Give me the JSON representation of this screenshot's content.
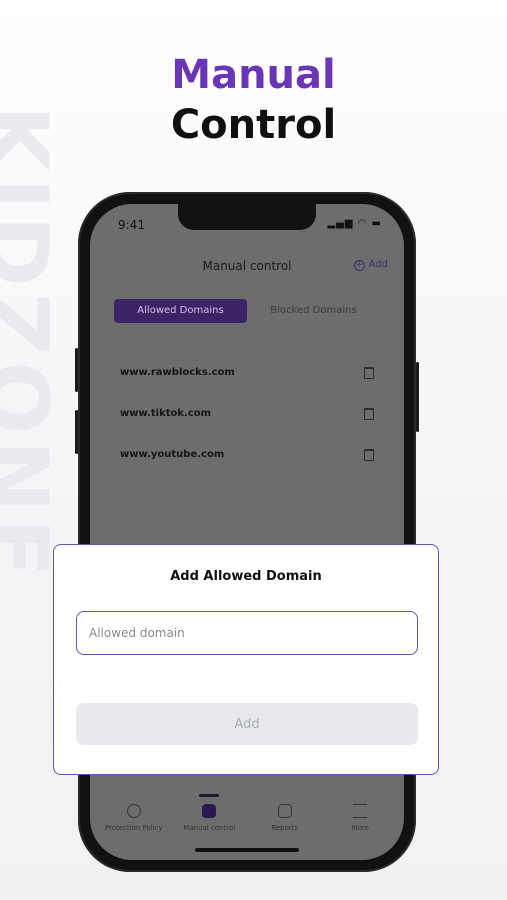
{
  "headline": {
    "line1": "Manual",
    "line2": "Control"
  },
  "watermark": "KIDZONE",
  "status": {
    "time": "9:41",
    "icons": "▂▄▆ ◠ ▬"
  },
  "app": {
    "title": "Manual control",
    "add_label": "Add",
    "tabs": [
      {
        "label": "Allowed Domains",
        "active": true
      },
      {
        "label": "Blocked Domains",
        "active": false
      }
    ],
    "domains": [
      "www.rawblocks.com",
      "www.tiktok.com",
      "www.youtube.com"
    ],
    "bottom_tabs": [
      {
        "label": "Protection Policy",
        "active": false
      },
      {
        "label": "Manual control",
        "active": true
      },
      {
        "label": "Reports",
        "active": false
      },
      {
        "label": "More",
        "active": false
      }
    ]
  },
  "dialog": {
    "title": "Add Allowed Domain",
    "input_placeholder": "Allowed domain",
    "input_value": "",
    "add_button": "Add"
  },
  "colors": {
    "accent": "#6a35b6",
    "dialog_border": "#6b4fa8",
    "overlay": "#6d6d6d"
  }
}
